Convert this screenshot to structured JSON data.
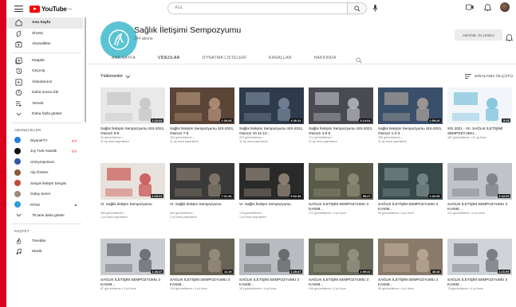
{
  "topbar": {
    "logo_text": "YouTube",
    "logo_region": "TR",
    "search_placeholder": "Ara"
  },
  "sidebar": {
    "main": [
      {
        "label": "Ana Sayfa",
        "icon": "home-icon",
        "active": true
      },
      {
        "label": "Shorts",
        "icon": "shorts-icon"
      },
      {
        "label": "Abonelikler",
        "icon": "subscriptions-icon"
      }
    ],
    "library": [
      {
        "label": "Kitaplık",
        "icon": "library-icon"
      },
      {
        "label": "Geçmiş",
        "icon": "history-icon"
      },
      {
        "label": "Videolarınız",
        "icon": "your-videos-icon"
      },
      {
        "label": "Daha sonra izle",
        "icon": "watch-later-icon"
      },
      {
        "label": "Yemek",
        "icon": "playlist-icon"
      },
      {
        "label": "Daha fazla göster",
        "icon": "chevron-down-icon"
      }
    ],
    "subs_heading": "ABONELİKLER",
    "subscriptions": [
      {
        "label": "DiyanetTV",
        "color": "#2a7fd4",
        "badge": "live"
      },
      {
        "label": "Joy Turk Akustik",
        "color": "#111111",
        "badge": "live"
      },
      {
        "label": "cimsymposium",
        "color": "#3355aa"
      },
      {
        "label": "Alp Özelen",
        "color": "#8a5a3a"
      },
      {
        "label": "Selçuk İletişim Dergisi",
        "color": "#c24a3a"
      },
      {
        "label": "Gülay Sezer",
        "color": "#9a8a7a"
      },
      {
        "label": "RTÜK",
        "color": "#2a9fd8",
        "badge": "dot"
      },
      {
        "label": "78 tane daha göster",
        "icon": "chevron-down-icon"
      }
    ],
    "explore_heading": "KEŞFET",
    "explore": [
      {
        "label": "Trendler",
        "icon": "trending-icon"
      },
      {
        "label": "Müzik",
        "icon": "music-icon"
      }
    ]
  },
  "channel": {
    "name": "Sağlık İletişimi Sempozyumu",
    "subscribers": "244 abone",
    "subscribe_label": "ABONE OLUNDU",
    "avatar_color": "#5bc4d4",
    "tabs": [
      "ANA SAYFA",
      "VİDEOLAR",
      "OYNATMA LİSTELERİ",
      "KANALLAR",
      "HAKKINDA"
    ],
    "active_tab": 1
  },
  "filter": {
    "uploads_label": "Yüklenenler",
    "sort_label": "SIRALAMA ÖLÇÜTÜ"
  },
  "videos": [
    {
      "title": "Sağlık İletişimi Sempozyumu SIS-2021, Oturum 8-9",
      "views": "51 görüntüleme •",
      "age": "11 ay önce yayınlandı",
      "duration": "1:13:43",
      "bg": "#e9e9e9",
      "fg": "#bcbcbc"
    },
    {
      "title": "Sağlık İletişimi Sempozyumu SIS-2021, Oturum 7-8",
      "views": "154 görüntüleme •",
      "age": "11 ay önce yayınlandı",
      "duration": "1:36:08",
      "bg": "#5a4536",
      "fg": "#c9a58a"
    },
    {
      "title": "Sağlık İletişimi Sempozyumu SIS-2021, Oturum 10-11-12...",
      "views": "231 görüntüleme •",
      "age": "11 ay önce yayınlandı",
      "duration": "4:36:32",
      "bg": "#2f3a4a",
      "fg": "#8a9ab0"
    },
    {
      "title": "Sağlık İletişimi Sempozyumu SIS-2021, Oturum 4-5-6",
      "views": "172 görüntüleme •",
      "age": "11 ay önce yayınlandı",
      "duration": "3:14:04",
      "bg": "#4a4a52",
      "fg": "#d0d0d8"
    },
    {
      "title": "Sağlık İletişimi Sempozyumu SIS-2021, Oturum 1-2-3",
      "views": "305 görüntüleme •",
      "age": "11 ay önce yayınlandı",
      "duration": "2:59:26",
      "bg": "#3a4f6a",
      "fg": "#c4b5a5"
    },
    {
      "title": "SİS 2021 - VII. SAĞLIK İLETİŞİMİ SEMPOZYUMU...",
      "views": "187 görüntüleme • 11 ay önce",
      "age": "",
      "duration": "5:15",
      "bg": "#f2f6fa",
      "fg": "#5bb5d4"
    },
    {
      "title": "VI. Sağlık İletişim Sempozyumu",
      "views": "489 görüntüleme •",
      "age": "1 yıl önce yayınlandı",
      "duration": "2:10:21",
      "bg": "#e8e2dc",
      "fg": "#c23030"
    },
    {
      "title": "VI. Sağlık İletişim Sempozyumu",
      "views": "544 görüntüleme •",
      "age": "1 yıl önce yayınlandı",
      "duration": "7:21:46",
      "bg": "#3a3a3a",
      "fg": "#9a8a7a"
    },
    {
      "title": "VI. Sağlık İletişim Sempozyumu",
      "views": "1 B görüntüleme •",
      "age": "1 yıl önce yayınlandı",
      "duration": "9:02:36",
      "bg": "#2a2a2a",
      "fg": "#b0a090"
    },
    {
      "title": "SAĞLIK İLETİŞİM SEMPOZYUMU 3 KASIM...",
      "views": "172 görüntüleme • 4 yıl önce",
      "age": "",
      "duration": "55:27",
      "bg": "#5a5a4a",
      "fg": "#9a9a80"
    },
    {
      "title": "SAĞLIK İLETİŞİM SEMPOZYUMU 3 KASIM...",
      "views": "95 görüntüleme • 4 yıl önce",
      "age": "",
      "duration": "1:32:53",
      "bg": "#3a4a4a",
      "fg": "#8a9a9a"
    },
    {
      "title": "SAĞLIK İLETİŞİM SEMPOZYUMU 3 KASIM...",
      "views": "141 görüntüleme • 4 yıl önce",
      "age": "",
      "duration": "1:12:03",
      "bg": "#c0c4c8",
      "fg": "#6a6a70"
    },
    {
      "title": "SAĞLIK İLETİŞİM SEMPOZYUMU 3 KASIM...",
      "views": "87 görüntüleme • 4 yıl önce",
      "age": "",
      "duration": "1:26:37",
      "bg": "#c8ccd0",
      "fg": "#4a4a55"
    },
    {
      "title": "SAĞLIK İLETİŞİM SEMPOZYUMU 3 KASIM...",
      "views": "129 görüntüleme • 4 yıl önce",
      "age": "",
      "duration": "11:19",
      "bg": "#6a6458",
      "fg": "#a89a88"
    },
    {
      "title": "SAĞLIK İLETİŞİM SEMPOZYUMU 3 KASIM...",
      "views": "113 görüntüleme • 4 yıl önce",
      "age": "",
      "duration": "1:25:47",
      "bg": "#b8bcc0",
      "fg": "#4a4a4a"
    },
    {
      "title": "SAĞLIK İLETİŞİM SEMPOZYUMU 3 KASIM...",
      "views": "106 görüntüleme • 4 yıl önce",
      "age": "",
      "duration": "1:09:22",
      "bg": "#6a6a5a",
      "fg": "#a0a090"
    },
    {
      "title": "SAĞLIK İLETİŞİM SEMPOZYUMU 3 KASIM...",
      "views": "95 görüntüleme • 4 yıl önce",
      "age": "",
      "duration": "46:43",
      "bg": "#8a7a6a",
      "fg": "#c8b8a0"
    },
    {
      "title": "SAĞLIK İLETİŞİM SEMPOZYUMU 3 KASIM...",
      "views": "75 görüntüleme • 4 yıl önce",
      "age": "",
      "duration": "1:21:09",
      "bg": "#d0d4d8",
      "fg": "#5a5a62"
    }
  ]
}
